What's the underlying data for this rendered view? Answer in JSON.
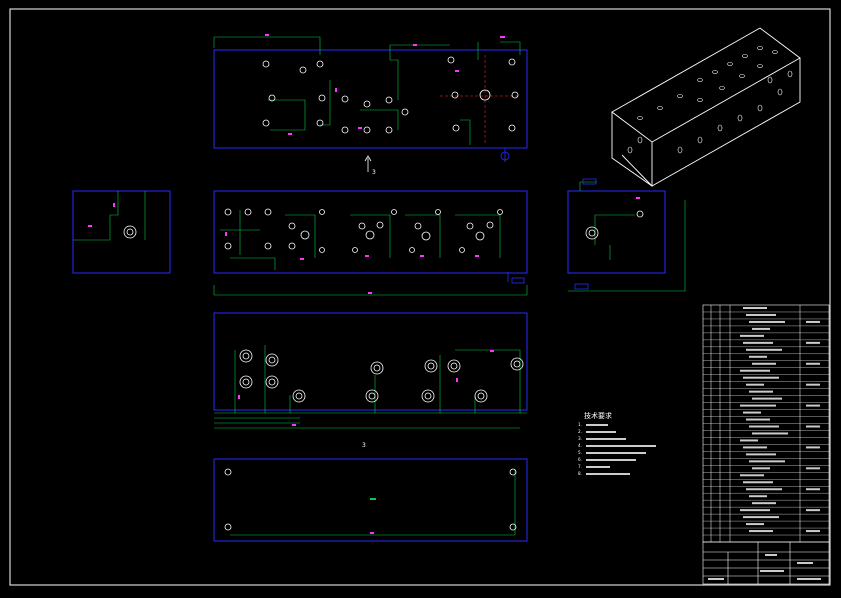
{
  "drawing": {
    "view_marker_top": "3",
    "view_marker_bottom": "3",
    "tech_notes": {
      "title": "技术要求",
      "lines": [
        "1.",
        "2.",
        "3.",
        "4.",
        "5.",
        "6.",
        "7.",
        "8."
      ]
    },
    "title_block": {
      "drawing_number": "",
      "part_name": ""
    }
  },
  "colors": {
    "background": "#000000",
    "border": "#ffffff",
    "view_frame": "#1a1aff",
    "dimension": "#00cc44",
    "dimension_text": "#ff33ff",
    "hole_outline": "#ffffff",
    "center_mark": "#ff3333"
  }
}
